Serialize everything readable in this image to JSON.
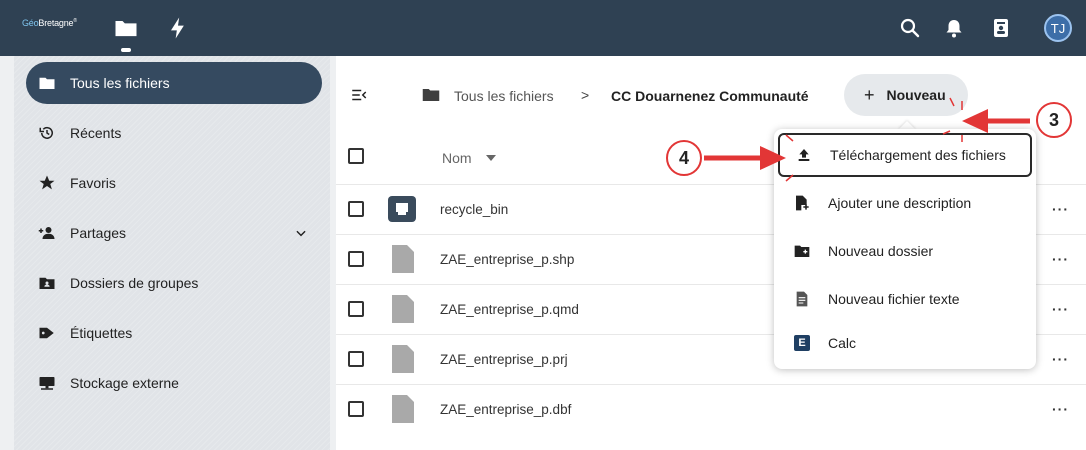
{
  "header": {
    "logo_part1": "Géo",
    "logo_part2": "Bretagne",
    "logo_mark": "®",
    "avatar_initials": "TJ",
    "apps": [
      {
        "name": "files",
        "icon": "folder-icon"
      },
      {
        "name": "activity",
        "icon": "lightning-icon"
      }
    ],
    "icons": [
      "search-icon",
      "bell-icon",
      "contacts-icon"
    ],
    "colors": {
      "bar": "#2f4153",
      "avatar": "#3d6ea8"
    }
  },
  "sidebar": {
    "items": [
      {
        "label": "Tous les fichiers",
        "icon": "folder-icon",
        "active": true
      },
      {
        "label": "Récents",
        "icon": "history-icon"
      },
      {
        "label": "Favoris",
        "icon": "star-icon"
      },
      {
        "label": "Partages",
        "icon": "share-icon",
        "expandable": true
      },
      {
        "label": "Dossiers de groupes",
        "icon": "group-folder-icon"
      },
      {
        "label": "Étiquettes",
        "icon": "tag-icon"
      },
      {
        "label": "Stockage externe",
        "icon": "external-storage-icon"
      }
    ],
    "active_color": "#354a60"
  },
  "breadcrumb": {
    "root": "Tous les fichiers",
    "separator": ">",
    "current": "CC Douarnenez Communauté"
  },
  "new_button": {
    "plus": "+",
    "label": "Nouveau"
  },
  "file_list": {
    "column_name": "Nom",
    "more": "···",
    "rows": [
      {
        "name": "recycle_bin",
        "type": "folder"
      },
      {
        "name": "ZAE_entreprise_p.shp",
        "type": "file"
      },
      {
        "name": "ZAE_entreprise_p.qmd",
        "type": "file"
      },
      {
        "name": "ZAE_entreprise_p.prj",
        "type": "file"
      },
      {
        "name": "ZAE_entreprise_p.dbf",
        "type": "file"
      }
    ]
  },
  "menu": {
    "items": [
      {
        "label": "Téléchargement des fichiers",
        "icon": "upload-icon",
        "highlighted": true
      },
      {
        "label": "Ajouter une description",
        "icon": "add-description-icon"
      },
      {
        "label": "Nouveau dossier",
        "icon": "new-folder-icon"
      },
      {
        "label": "Nouveau fichier texte",
        "icon": "text-file-icon"
      },
      {
        "label": "Calc",
        "icon": "calc-icon",
        "icon_letter": "E"
      }
    ]
  },
  "annotations": {
    "step3": "3",
    "step4": "4",
    "color": "#e23636"
  }
}
